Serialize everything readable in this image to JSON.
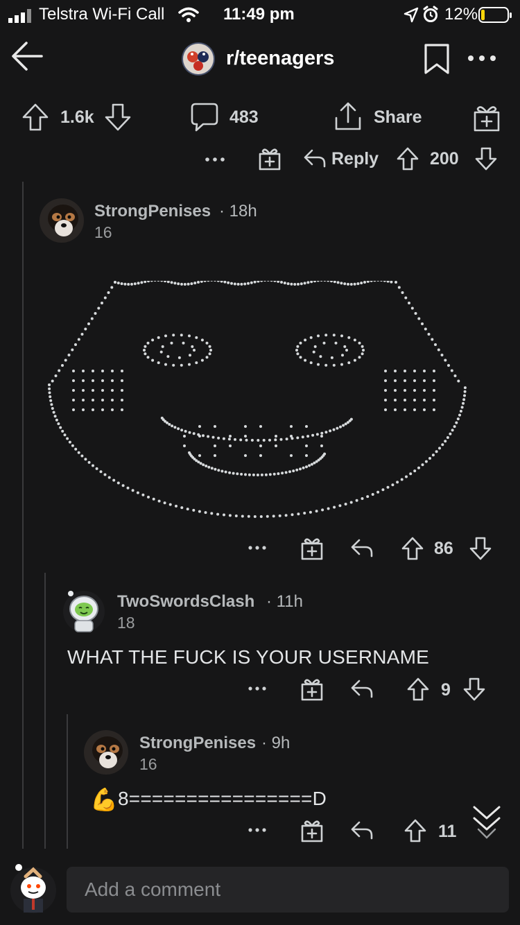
{
  "status_bar": {
    "carrier": "Telstra Wi-Fi Call",
    "time": "11:49 pm",
    "battery": "12%"
  },
  "header": {
    "subreddit": "r/teenagers"
  },
  "post_actions": {
    "votes": "1.6k",
    "comments": "483",
    "share": "Share"
  },
  "parent_actions": {
    "reply": "Reply",
    "votes": "200"
  },
  "comments": [
    {
      "author": "StrongPenises",
      "age": "18h",
      "karma": "16",
      "body": "",
      "votes": "86"
    },
    {
      "author": "TwoSwordsClash",
      "age": "11h",
      "karma": "18",
      "body": "WHAT THE FUCK IS YOUR USERNAME",
      "votes": "9"
    },
    {
      "author": "StrongPenises",
      "age": "9h",
      "karma": "16",
      "body": "8================D",
      "votes": "11"
    }
  ],
  "composer": {
    "placeholder": "Add a comment"
  },
  "icons": {
    "flexed_biceps": "💪"
  },
  "colors": {
    "background": "#161617",
    "text": "#d7dadc",
    "thread_line": "#3a3a3c",
    "composer_box": "#252527"
  }
}
